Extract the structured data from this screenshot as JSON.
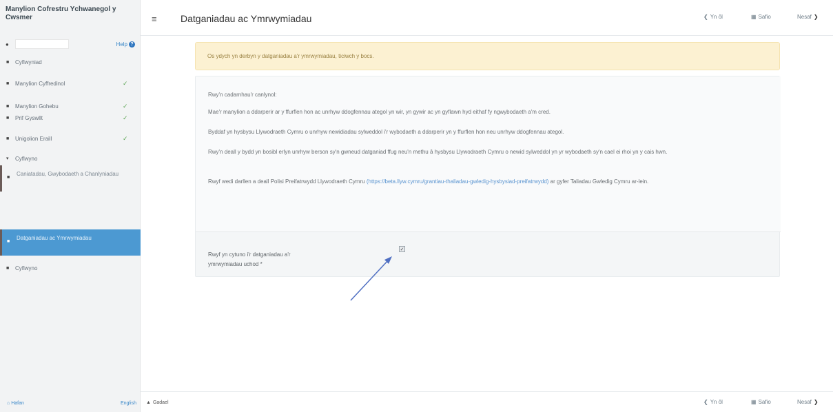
{
  "sidebar": {
    "title": "Manylion Cofrestru Ychwanegol y Cwsmer",
    "help_label": "Help",
    "items": [
      {
        "label": "Cyflwyniad",
        "complete": false
      },
      {
        "label": "Manylion Cyffredinol",
        "complete": true
      },
      {
        "label": "Manylion Gohebu",
        "complete": true
      },
      {
        "label": "Prif Gyswllt",
        "complete": true
      },
      {
        "label": "Unigolion Eraill",
        "complete": true
      },
      {
        "label": "Cyflwyno",
        "complete": false
      }
    ],
    "sub_items": [
      {
        "label": "Caniatadau, Gwybodaeth a Chanlyniadau"
      },
      {
        "label": "Datganiadau ac Ymrwymiadau",
        "active": true
      }
    ],
    "last_item": "Cyflwyno",
    "footer": {
      "home": "Hafan",
      "language": "English"
    }
  },
  "header": {
    "title": "Datganiadau ac Ymrwymiadau",
    "back": "Yn ôl",
    "save": "Safio",
    "next": "Nesaf"
  },
  "alert": "Os ydych yn derbyn y datganiadau a'r ymrwymiadau, ticiwch y bocs.",
  "declarations": {
    "intro": "Rwy'n cadarnhau'r canlynol:",
    "p1": "Mae'r manylion a ddarperir ar y ffurflen hon ac unrhyw ddogfennau ategol yn wir, yn gywir ac yn gyflawn hyd eithaf fy ngwybodaeth a'm cred.",
    "p2": "Byddaf yn hysbysu Llywodraeth Cymru o unrhyw newidiadau sylweddol i'r wybodaeth a ddarperir yn y ffurflen hon neu unrhyw ddogfennau ategol.",
    "p3": "Rwy'n deall y bydd yn bosibl erlyn unrhyw berson sy'n gwneud datganiad ffug neu'n methu â hysbysu Llywodraeth Cymru o newid sylweddol yn yr wybodaeth sy'n cael ei rhoi yn y cais hwn.",
    "p4_before": "Rwyf wedi darllen a deall Polisi Preifatrwydd Llywodraeth Cymru ",
    "p4_link": "(https://beta.llyw.cymru/grantiau-thaliadau-gwledig-hysbysiad-preifatrwydd)",
    "p4_after": " ar gyfer Taliadau Gwledig Cymru ar-lein."
  },
  "agree": {
    "label": "Rwyf yn cytuno i'r datganiadau a'r ymrwymiadau uchod *",
    "checked": true
  },
  "footer": {
    "up_label": "Gadael",
    "back": "Yn ôl",
    "save": "Safio",
    "next": "Nesaf"
  },
  "colors": {
    "accent": "#4c99d2",
    "alert_bg": "#fcf1d2",
    "link": "#5a94d0",
    "check": "#5da455"
  },
  "icons": [
    "user-icon",
    "help-icon",
    "book-icon",
    "check-icon",
    "chevron-down-icon",
    "hamburger-icon",
    "chevron-left-icon",
    "save-icon",
    "chevron-right-icon",
    "home-icon",
    "arrow-up-icon"
  ]
}
